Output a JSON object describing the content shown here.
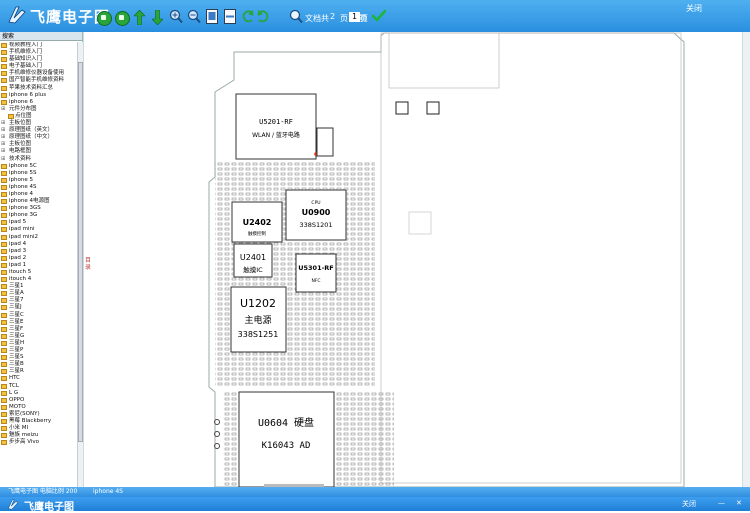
{
  "app": {
    "title": "飞鹰电子图",
    "close_label": "关闭",
    "colors": {
      "title_bar": "#2a8fe0",
      "folder": "#f2c33a",
      "confirm": "#1db53a"
    }
  },
  "toolbar": {
    "icons": [
      "previous-circle-icon",
      "next-circle-icon",
      "arrow-up-icon",
      "arrow-down-icon",
      "zoom-in-icon",
      "zoom-out-icon",
      "fit-page-icon",
      "fit-width-icon",
      "rotate-left-icon",
      "rotate-right-icon",
      "search-icon"
    ],
    "total_label": "文档共",
    "total_pages": "2",
    "current_label": "页 当前",
    "current_page": "1",
    "page_suffix": "页"
  },
  "sidebar": {
    "search_tab": "搜索",
    "side_tab": "目录",
    "items": [
      {
        "label": "视频教程入门",
        "type": "folder"
      },
      {
        "label": "手机维修入门",
        "type": "folder"
      },
      {
        "label": "基础知识入门",
        "type": "folder"
      },
      {
        "label": "电子基础入门",
        "type": "folder"
      },
      {
        "label": "手机维修仪器设备使用",
        "type": "folder"
      },
      {
        "label": "国产智能手机维修资料",
        "type": "folder"
      },
      {
        "label": "苹果技术资料汇总",
        "type": "folder"
      },
      {
        "label": "iphone 6 plus",
        "type": "folder"
      },
      {
        "label": "iphone 6",
        "type": "folder"
      },
      {
        "label": "元件分布图",
        "type": "expand"
      },
      {
        "label": "点位图",
        "type": "child"
      },
      {
        "label": "主板位图",
        "type": "expand"
      },
      {
        "label": "原理图纸（英文）",
        "type": "expand"
      },
      {
        "label": "原理图纸（中文）",
        "type": "expand"
      },
      {
        "label": "主板位图",
        "type": "expand"
      },
      {
        "label": "电路框图",
        "type": "expand"
      },
      {
        "label": "技术资料",
        "type": "expand"
      },
      {
        "label": "iphone 5C",
        "type": "folder"
      },
      {
        "label": "iphone 5S",
        "type": "folder"
      },
      {
        "label": "iphone 5",
        "type": "folder"
      },
      {
        "label": "iphone 4S",
        "type": "folder"
      },
      {
        "label": "iphone 4",
        "type": "folder"
      },
      {
        "label": "iphone 4电源图",
        "type": "folder"
      },
      {
        "label": "iphone 3GS",
        "type": "folder"
      },
      {
        "label": "iphone 3G",
        "type": "folder"
      },
      {
        "label": "ipad 5",
        "type": "folder"
      },
      {
        "label": "ipad mini",
        "type": "folder"
      },
      {
        "label": "ipad mini2",
        "type": "folder"
      },
      {
        "label": "ipad 4",
        "type": "folder"
      },
      {
        "label": "ipad 3",
        "type": "folder"
      },
      {
        "label": "ipad 2",
        "type": "folder"
      },
      {
        "label": "ipad 1",
        "type": "folder"
      },
      {
        "label": "itouch 5",
        "type": "folder"
      },
      {
        "label": "itouch 4",
        "type": "folder"
      },
      {
        "label": "三星1",
        "type": "folder"
      },
      {
        "label": "三星A",
        "type": "folder"
      },
      {
        "label": "三星7",
        "type": "folder"
      },
      {
        "label": "三星J",
        "type": "folder"
      },
      {
        "label": "三星C",
        "type": "folder"
      },
      {
        "label": "三星E",
        "type": "folder"
      },
      {
        "label": "三星F",
        "type": "folder"
      },
      {
        "label": "三星G",
        "type": "folder"
      },
      {
        "label": "三星H",
        "type": "folder"
      },
      {
        "label": "三星P",
        "type": "folder"
      },
      {
        "label": "三星S",
        "type": "folder"
      },
      {
        "label": "三星B",
        "type": "folder"
      },
      {
        "label": "三星R",
        "type": "folder"
      },
      {
        "label": "HTC",
        "type": "folder"
      },
      {
        "label": "TCL",
        "type": "folder"
      },
      {
        "label": "L G",
        "type": "folder"
      },
      {
        "label": "OPPO",
        "type": "folder"
      },
      {
        "label": "MOTO",
        "type": "folder"
      },
      {
        "label": "索尼(SONY)",
        "type": "folder"
      },
      {
        "label": "黑莓 Blackberry",
        "type": "folder"
      },
      {
        "label": "小米 MI",
        "type": "folder"
      },
      {
        "label": "魅族 meizu",
        "type": "folder"
      },
      {
        "label": "步步高 Vivo",
        "type": "folder"
      }
    ]
  },
  "board": {
    "chips": {
      "u5201": "U5201-RF",
      "u5201_sub": "WLAN / 蓝牙电路",
      "u2402": "U2402",
      "u2402_sub": "触摸控制",
      "u0900_top": "CPU",
      "u0900": "U0900",
      "u0900_sub": "338S1201",
      "u2401": "U2401",
      "u2401_sub": "触摸IC",
      "u5301": "U5301-RF",
      "u5301_sub": "NFC",
      "u1202": "U1202",
      "u1202_sub": "主电源",
      "u1202_part": "338S1251",
      "u0604": "U0604 硬盘",
      "u0604_part": "K16043 AD"
    }
  },
  "status": {
    "left": "飞鹰电子图 电脑比例 200",
    "middle": "iphone 4S"
  },
  "taskbar": {
    "title": "飞鹰电子图"
  }
}
